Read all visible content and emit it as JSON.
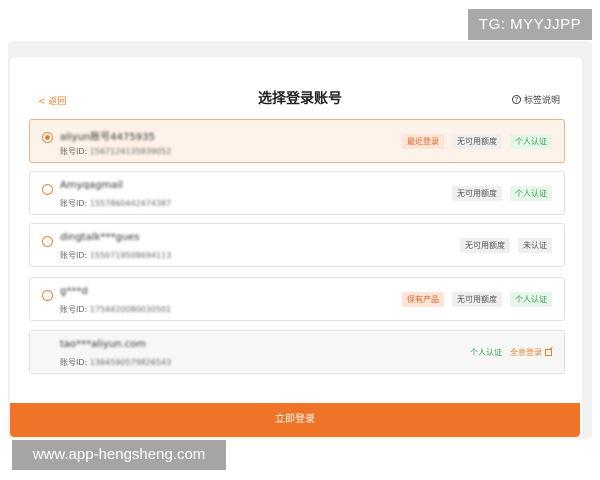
{
  "watermark_top": "TG: MYYJJPP",
  "watermark_bottom": "www.app-hengsheng.com",
  "header": {
    "back": "< 返回",
    "title": "选择登录账号",
    "tag_help": "标签说明"
  },
  "accounts": [
    {
      "name": "aliyun账号4475935",
      "id_label": "账号ID:",
      "id_value": "1567124135839052",
      "selected": true,
      "tags": [
        "最近登录",
        "无可用额度",
        "个人认证"
      ]
    },
    {
      "name": "Amyqagmail",
      "id_label": "账号ID:",
      "id_value": "1557860442474387",
      "selected": false,
      "tags": [
        "无可用额度",
        "个人认证"
      ]
    },
    {
      "name": "dingtalk***gues",
      "id_label": "账号ID:",
      "id_value": "1550719508694113",
      "selected": false,
      "tags": [
        "无可用额度",
        "未认证"
      ]
    },
    {
      "name": "g***d",
      "id_label": "账号ID:",
      "id_value": "1754420080030501",
      "selected": false,
      "tags": [
        "保有产品",
        "无可用额度",
        "个人认证"
      ]
    },
    {
      "name": "tao***aliyun.com",
      "id_label": "账号ID:",
      "id_value": "1364590579826543",
      "selected": false,
      "tags": [
        "个人认证",
        "全息登录"
      ]
    }
  ],
  "login_button": "立即登录",
  "colors": {
    "accent": "#f07427",
    "tag_orange_bg": "#fce4d6",
    "tag_green_text": "#2f9e4a"
  }
}
